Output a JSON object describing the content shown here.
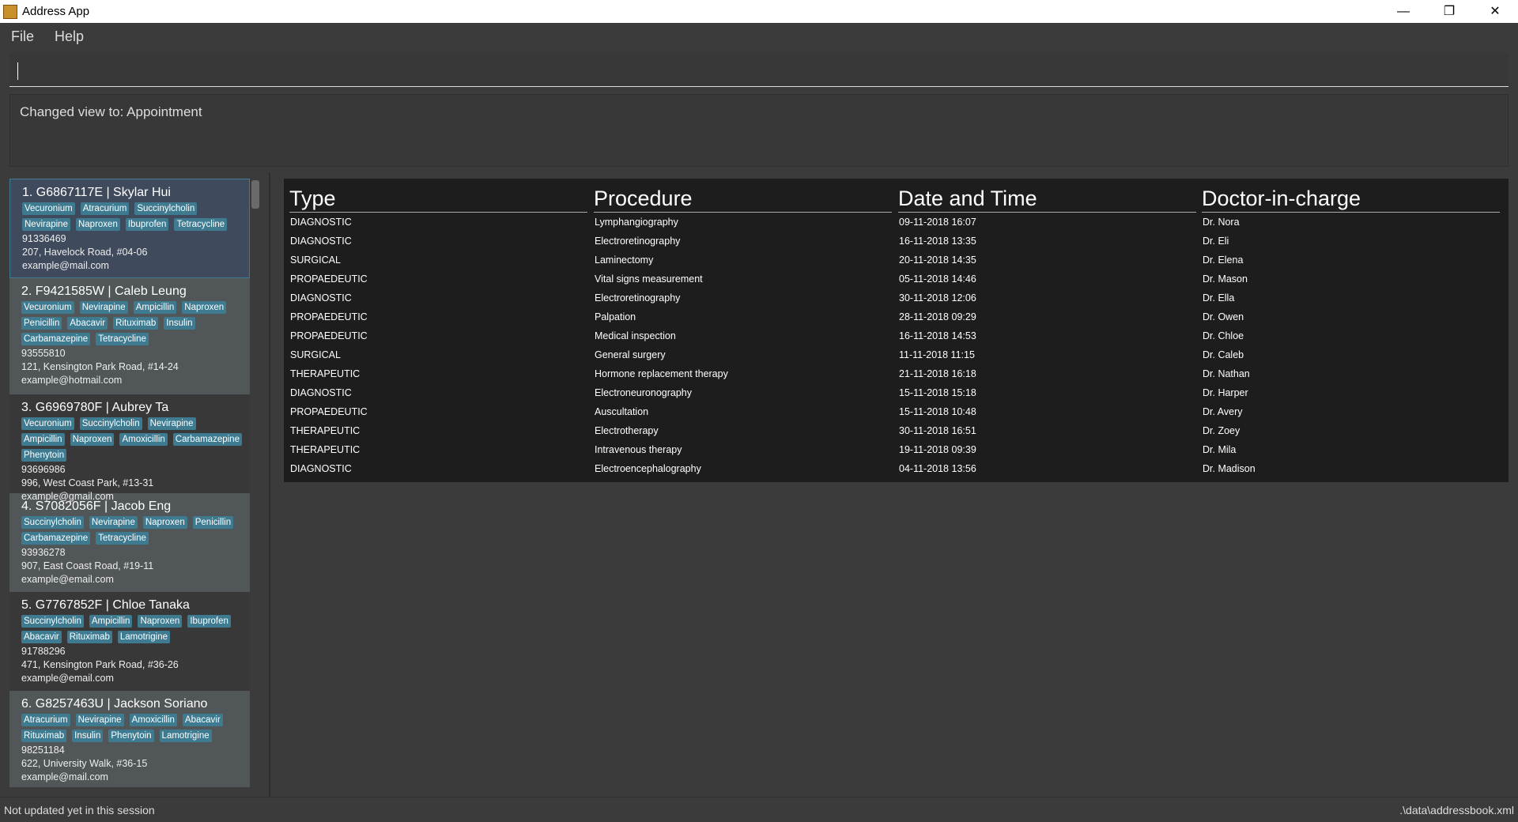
{
  "window": {
    "title": "Address App",
    "minimize": "—",
    "maximize": "❐",
    "close": "✕"
  },
  "menu": {
    "file": "File",
    "help": "Help"
  },
  "command": {
    "value": ""
  },
  "result": {
    "text": "Changed view to: Appointment"
  },
  "persons": [
    {
      "title": "1.  G6867117E | Skylar Hui",
      "tags": [
        "Vecuronium",
        "Atracurium",
        "Succinylcholin",
        "Nevirapine",
        "Naproxen",
        "Ibuprofen",
        "Tetracycline"
      ],
      "phone": "91336469",
      "address": "207, Havelock Road, #04-06",
      "email": "example@mail.com"
    },
    {
      "title": "2.  F9421585W | Caleb Leung",
      "tags": [
        "Vecuronium",
        "Nevirapine",
        "Ampicillin",
        "Naproxen",
        "Penicillin",
        "Abacavir",
        "Rituximab",
        "Insulin",
        "Carbamazepine",
        "Tetracycline"
      ],
      "phone": "93555810",
      "address": "121, Kensington Park Road, #14-24",
      "email": "example@hotmail.com"
    },
    {
      "title": "3.  G6969780F | Aubrey Ta",
      "tags": [
        "Vecuronium",
        "Succinylcholin",
        "Nevirapine",
        "Ampicillin",
        "Naproxen",
        "Amoxicillin",
        "Carbamazepine",
        "Phenytoin"
      ],
      "phone": "93696986",
      "address": "996, West Coast Park, #13-31",
      "email": "example@gmail.com"
    },
    {
      "title": "4.  S7082056F | Jacob Eng",
      "tags": [
        "Succinylcholin",
        "Nevirapine",
        "Naproxen",
        "Penicillin",
        "Carbamazepine",
        "Tetracycline"
      ],
      "phone": "93936278",
      "address": "907, East Coast Road, #19-11",
      "email": "example@email.com"
    },
    {
      "title": "5.  G7767852F | Chloe Tanaka",
      "tags": [
        "Succinylcholin",
        "Ampicillin",
        "Naproxen",
        "Ibuprofen",
        "Abacavir",
        "Rituximab",
        "Lamotrigine"
      ],
      "phone": "91788296",
      "address": "471, Kensington Park Road, #36-26",
      "email": "example@email.com"
    },
    {
      "title": "6.  G8257463U | Jackson Soriano",
      "tags": [
        "Atracurium",
        "Nevirapine",
        "Amoxicillin",
        "Abacavir",
        "Rituximab",
        "Insulin",
        "Phenytoin",
        "Lamotrigine"
      ],
      "phone": "98251184",
      "address": "622, University Walk, #36-15",
      "email": "example@mail.com"
    }
  ],
  "table": {
    "headers": [
      "Type",
      "Procedure",
      "Date and Time",
      "Doctor-in-charge"
    ],
    "rows": [
      [
        "DIAGNOSTIC",
        "Lymphangiography",
        "09-11-2018 16:07",
        "Dr. Nora"
      ],
      [
        "DIAGNOSTIC",
        "Electroretinography",
        "16-11-2018 13:35",
        "Dr. Eli"
      ],
      [
        "SURGICAL",
        "Laminectomy",
        "20-11-2018 14:35",
        "Dr. Elena"
      ],
      [
        "PROPAEDEUTIC",
        "Vital signs measurement",
        "05-11-2018 14:46",
        "Dr. Mason"
      ],
      [
        "DIAGNOSTIC",
        "Electroretinography",
        "30-11-2018 12:06",
        "Dr. Ella"
      ],
      [
        "PROPAEDEUTIC",
        "Palpation",
        "28-11-2018 09:29",
        "Dr. Owen"
      ],
      [
        "PROPAEDEUTIC",
        "Medical inspection",
        "16-11-2018 14:53",
        "Dr. Chloe"
      ],
      [
        "SURGICAL",
        "General surgery",
        "11-11-2018 11:15",
        "Dr. Caleb"
      ],
      [
        "THERAPEUTIC",
        "Hormone replacement therapy",
        "21-11-2018 16:18",
        "Dr. Nathan"
      ],
      [
        "DIAGNOSTIC",
        "Electroneuronography",
        "15-11-2018 15:18",
        "Dr. Harper"
      ],
      [
        "PROPAEDEUTIC",
        "Auscultation",
        "15-11-2018 10:48",
        "Dr. Avery"
      ],
      [
        "THERAPEUTIC",
        "Electrotherapy",
        "30-11-2018 16:51",
        "Dr. Zoey"
      ],
      [
        "THERAPEUTIC",
        "Intravenous therapy",
        "19-11-2018 09:39",
        "Dr. Mila"
      ],
      [
        "DIAGNOSTIC",
        "Electroencephalography",
        "04-11-2018 13:56",
        "Dr. Madison"
      ]
    ]
  },
  "status": {
    "left": "Not updated yet in this session",
    "right": ".\\data\\addressbook.xml"
  }
}
